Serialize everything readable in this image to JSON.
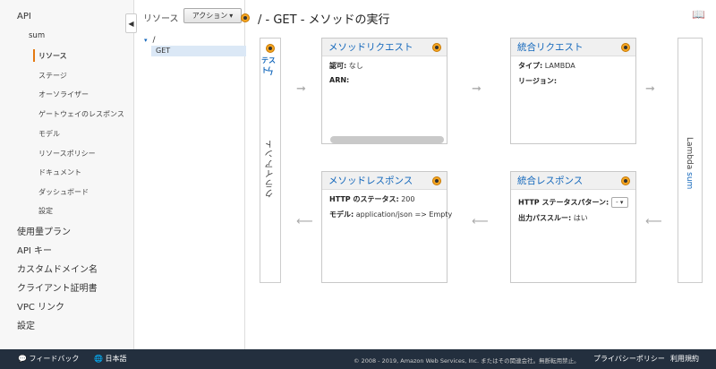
{
  "sidebar": {
    "api": "API",
    "api_name": "sum",
    "items": [
      {
        "label": "リソース"
      },
      {
        "label": "ステージ"
      },
      {
        "label": "オーソライザー"
      },
      {
        "label": "ゲートウェイのレスポンス"
      },
      {
        "label": "モデル"
      },
      {
        "label": "リソースポリシー"
      },
      {
        "label": "ドキュメント"
      },
      {
        "label": "ダッシュボード"
      },
      {
        "label": "設定"
      }
    ],
    "top_items": [
      {
        "label": "使用量プラン"
      },
      {
        "label": "API キー"
      },
      {
        "label": "カスタムドメイン名"
      },
      {
        "label": "クライアント証明書"
      },
      {
        "label": "VPC リンク"
      },
      {
        "label": "設定"
      }
    ],
    "collapse_icon": "◀"
  },
  "resources": {
    "title": "リソース",
    "actions_label": "アクション",
    "actions_caret": "▾",
    "tree_caret": "▾",
    "root": "/",
    "method": "GET"
  },
  "main": {
    "title": "/ - GET - メソッドの実行",
    "book_icon": "📖"
  },
  "client": {
    "test_label": "テスト",
    "bolt": "ϟ",
    "label": "クライアント"
  },
  "lambda": {
    "prefix": "Lambda",
    "function": "sum"
  },
  "method_request": {
    "title": "メソッドリクエスト",
    "auth_label": "認可:",
    "auth_value": "なし",
    "arn_label": "ARN:"
  },
  "integration_request": {
    "title": "統合リクエスト",
    "type_label": "タイプ:",
    "type_value": "LAMBDA",
    "region_label": "リージョン:"
  },
  "method_response": {
    "title": "メソッドレスポンス",
    "status_label": "HTTP のステータス:",
    "status_value": "200",
    "model_label": "モデル:",
    "model_value": "application/json => Empty"
  },
  "integration_response": {
    "title": "統合レスポンス",
    "pattern_label": "HTTP ステータスパターン:",
    "pattern_value": "-",
    "pattern_caret": "▾",
    "passthrough_label": "出力パススルー:",
    "passthrough_value": "はい"
  },
  "arrows": {
    "right": "➞",
    "left": "⟵"
  },
  "footer": {
    "feedback": "フィードバック",
    "language": "日本語",
    "copyright": "© 2008 - 2019, Amazon Web Services, Inc. またはその関連会社。無断転用禁止。",
    "privacy": "プライバシーポリシー",
    "terms": "利用規約",
    "feedback_icon": "💬",
    "globe_icon": "🌐"
  }
}
